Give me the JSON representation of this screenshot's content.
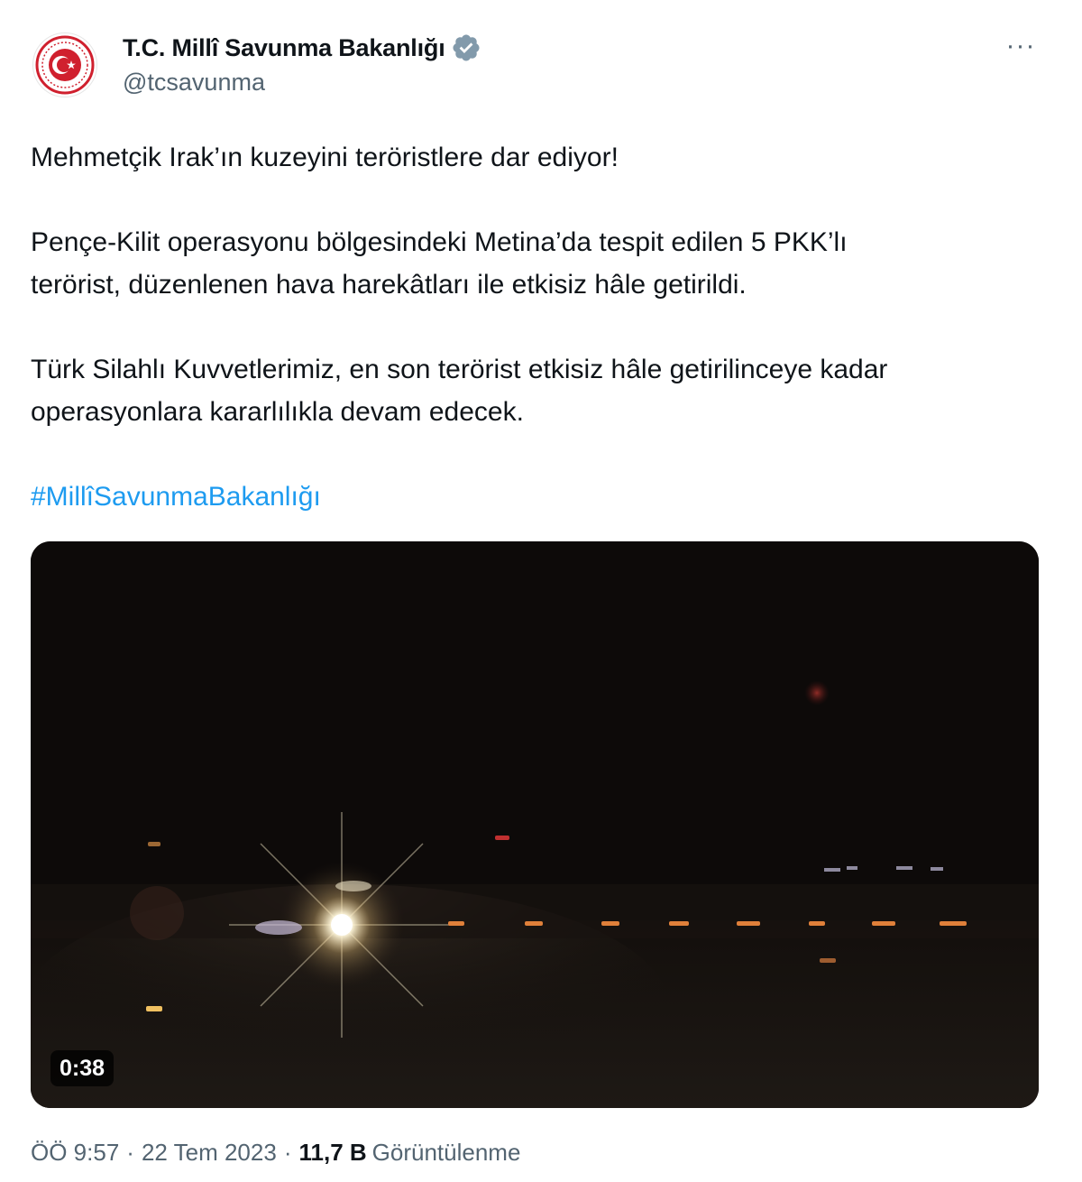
{
  "account": {
    "display_name": "T.C. Millî Savunma Bakanlığı",
    "handle": "@tcsavunma",
    "verified": true,
    "avatar_icon": "ministry-emblem-icon",
    "verified_icon": "verified-badge-icon",
    "badge_color": "#829aab"
  },
  "menu": {
    "icon": "more-options-icon",
    "glyph": "···"
  },
  "tweet": {
    "paragraphs": [
      [
        "Mehmetçik Irak’ın kuzeyini teröristlere dar ediyor!"
      ],
      [
        "Pençe-Kilit operasyonu bölgesindeki Metina’da tespit edilen 5 PKK’lı",
        "terörist, düzenlenen hava harekâtları ile etkisiz hâle getirildi."
      ],
      [
        "Türk Silahlı Kuvvetlerimiz, en son terörist etkisiz hâle getirilinceye kadar",
        "operasyonlara kararlılıkla devam edecek."
      ]
    ],
    "hashtag": "#MillîSavunmaBakanlığı"
  },
  "media": {
    "type": "video",
    "duration": "0:38"
  },
  "meta": {
    "time": "ÖÖ 9:57",
    "separator": "·",
    "date": "22 Tem 2023",
    "views_count": "11,7 B",
    "views_label": "Görüntülenme"
  },
  "colors": {
    "text": "#0f1419",
    "secondary": "#536471",
    "link": "#1d9bf0",
    "emblem_red": "#d0202e"
  }
}
